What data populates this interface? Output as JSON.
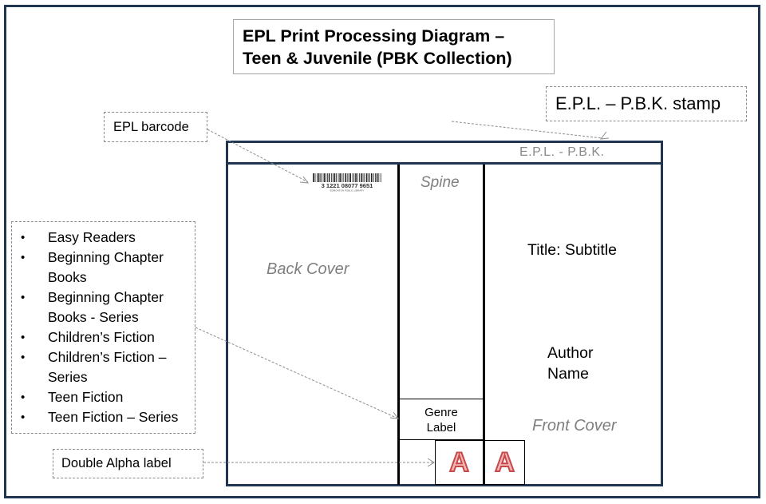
{
  "title": {
    "line1": "EPL Print Processing Diagram –",
    "line2": "Teen & Juvenile (PBK Collection)"
  },
  "callouts": {
    "stamp": "E.P.L. – P.B.K. stamp",
    "barcode": "EPL barcode",
    "double_alpha": "Double Alpha label"
  },
  "collections": [
    {
      "line1": "Easy Readers"
    },
    {
      "line1": "Beginning Chapter",
      "line2": "Books"
    },
    {
      "line1": "Beginning Chapter",
      "line2": "Books - Series"
    },
    {
      "line1": "Children’s Fiction"
    },
    {
      "line1": "Children’s Fiction –",
      "line2": "Series"
    },
    {
      "line1": "Teen Fiction"
    },
    {
      "line1": "Teen Fiction – Series"
    }
  ],
  "bullet_glyph": "•",
  "book": {
    "stamp_text": "E.P.L. - P.B.K.",
    "back_cover": "Back Cover",
    "spine": "Spine",
    "front_cover": "Front Cover",
    "title": "Title: Subtitle",
    "author_line1": "Author",
    "author_line2": "Name",
    "genre_line1": "Genre",
    "genre_line2": "Label",
    "alpha_letter_1": "A",
    "alpha_letter_2": "A",
    "barcode_number": "3 1221 08077 9651",
    "barcode_caption": "EDMONTON PUBLIC LIBRARY"
  },
  "colors": {
    "frame": "#1f3551",
    "callout_border": "#8c8c8c",
    "muted_text": "#7f7f7f",
    "alpha_stroke": "#c9484a",
    "alpha_fill": "#f2b8b8"
  }
}
